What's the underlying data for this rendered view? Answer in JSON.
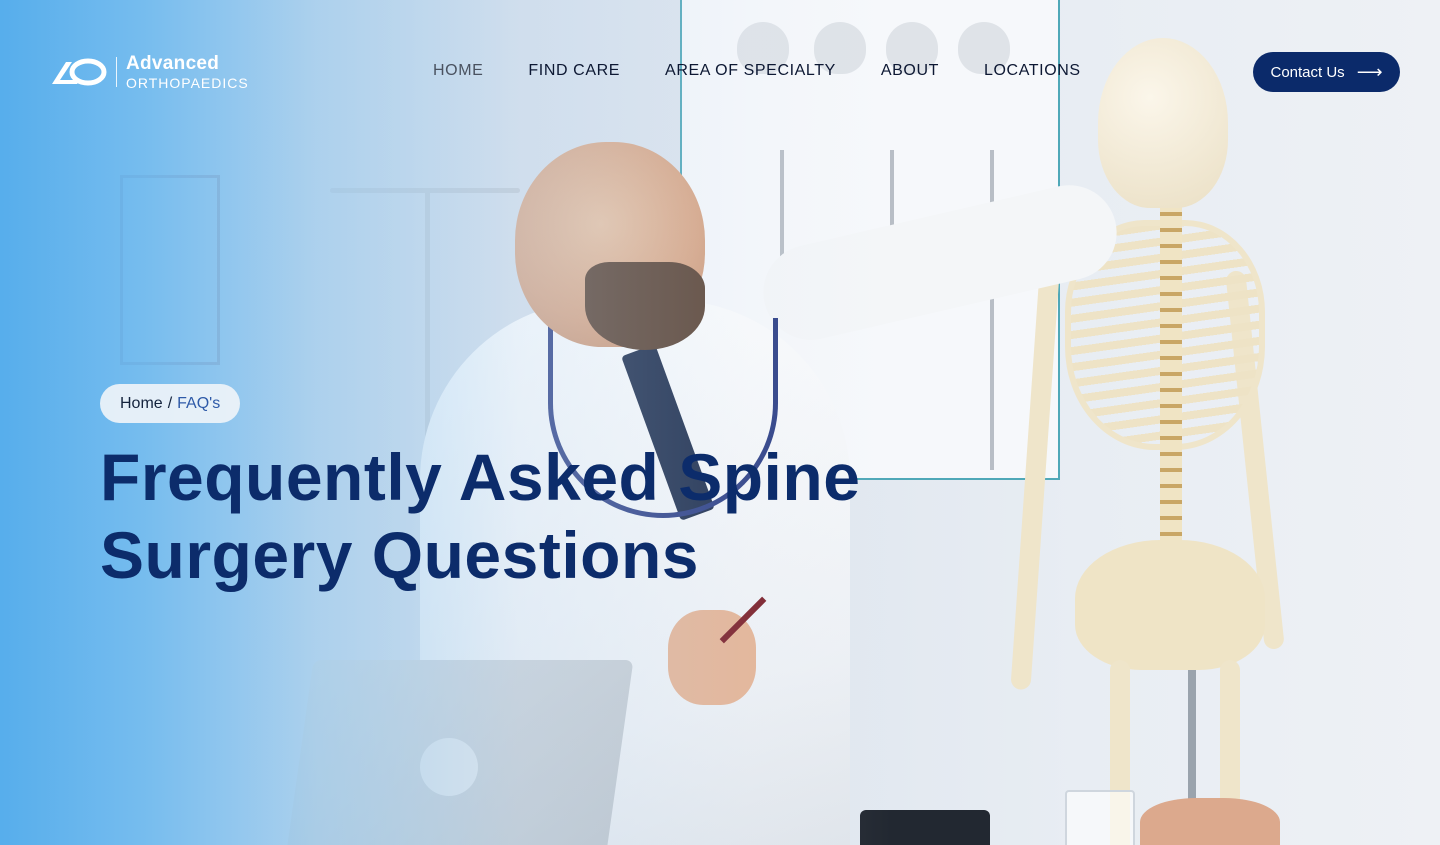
{
  "brand": {
    "name_line1": "Advanced",
    "name_line2": "ORTHOPAEDICS",
    "logo_icon": "ao-logo-icon"
  },
  "nav": {
    "items": [
      {
        "label": "HOME",
        "active": true
      },
      {
        "label": "FIND CARE",
        "active": false
      },
      {
        "label": "AREA OF SPECIALTY",
        "active": false
      },
      {
        "label": "ABOUT",
        "active": false
      },
      {
        "label": "LOCATIONS",
        "active": false
      }
    ]
  },
  "header": {
    "contact_label": "Contact Us",
    "contact_icon": "arrow-right-icon"
  },
  "breadcrumb": {
    "home": "Home",
    "separator": "/",
    "current": "FAQ's"
  },
  "hero": {
    "title_line1": "Frequently Asked Spine",
    "title_line2": "Surgery Questions"
  },
  "colors": {
    "primary": "#0b2a6a",
    "title": "#0c2c6b",
    "overlay_blue": "#52acec",
    "breadcrumb_bg": "#ecf2f9",
    "breadcrumb_link": "#2e5aa8"
  }
}
